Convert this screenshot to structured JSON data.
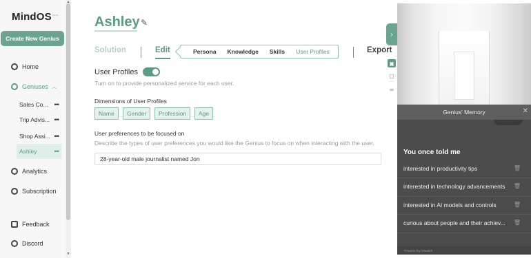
{
  "sidebar": {
    "logo": "MindOS",
    "logo_sup": "beta",
    "create_button": "Create New Genius",
    "nav": {
      "home": "Home",
      "geniuses": "Geniuses",
      "analytics": "Analytics",
      "subscription": "Subscription",
      "feedback": "Feedback",
      "discord": "Discord"
    },
    "genius_items": [
      "Sales Co...",
      "Trip Advis...",
      "Shop Assi...",
      "Ashley"
    ]
  },
  "main": {
    "title": "Ashley",
    "tabs": {
      "solution": "Solution",
      "edit": "Edit",
      "export": "Export"
    },
    "subtabs": [
      "Persona",
      "Knowledge",
      "Skills",
      "User Profiles"
    ],
    "user_profiles": {
      "title": "User Profiles",
      "toggle_on": true,
      "description": "Turn on to provide personalized service for each user.",
      "dimensions_label": "Dimensions of User Profiles",
      "dimensions": [
        "Name",
        "Gender",
        "Profession",
        "Age"
      ],
      "preferences_label": "User preferences to be focused on",
      "preferences_description": "Describe the types of user preferences you would like the Genius to focus on when interacting with the user.",
      "preferences_value": "28-year-old male journalist named Jon"
    }
  },
  "memory": {
    "header": "Genius' Memory",
    "heading": "You once told me",
    "items": [
      "interested in productivity tips",
      "interested in technology advancements",
      "interested in AI models and controls",
      "curious about people and their achiev..."
    ],
    "footer": "Powered by MindOS"
  },
  "icons": {
    "edit": "pencil-icon",
    "collapse": "chevron-right-icon",
    "close": "close-icon",
    "trash": "trash-icon"
  },
  "colors": {
    "accent": "#5b9a86",
    "button": "#6ba391",
    "memory_bg": "#4c4c4c"
  }
}
